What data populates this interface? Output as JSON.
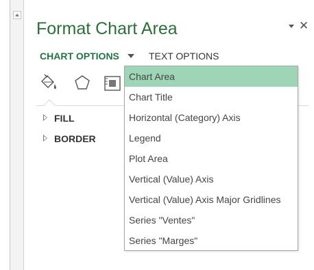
{
  "pane": {
    "title": "Format Chart Area",
    "menu_icon": "chevron-down-icon",
    "close_symbol": "✕"
  },
  "option_tabs": {
    "chart_options": "CHART OPTIONS",
    "text_options": "TEXT OPTIONS"
  },
  "category_icons": [
    "fill-line-icon",
    "effects-pentagon-icon",
    "size-properties-icon"
  ],
  "sections": [
    {
      "label": "FILL",
      "expanded": false
    },
    {
      "label": "BORDER",
      "expanded": false
    }
  ],
  "dropdown": {
    "selected": "Chart Area",
    "items": [
      "Chart Area",
      "Chart Title",
      "Horizontal (Category) Axis",
      "Legend",
      "Plot Area",
      "Vertical (Value) Axis",
      "Vertical (Value) Axis Major Gridlines",
      "Series \"Ventes\"",
      "Series \"Marges\""
    ]
  },
  "colors": {
    "title_green": "#2c6e3a",
    "tab_green": "#217346",
    "selection": "#9fd5b7"
  }
}
